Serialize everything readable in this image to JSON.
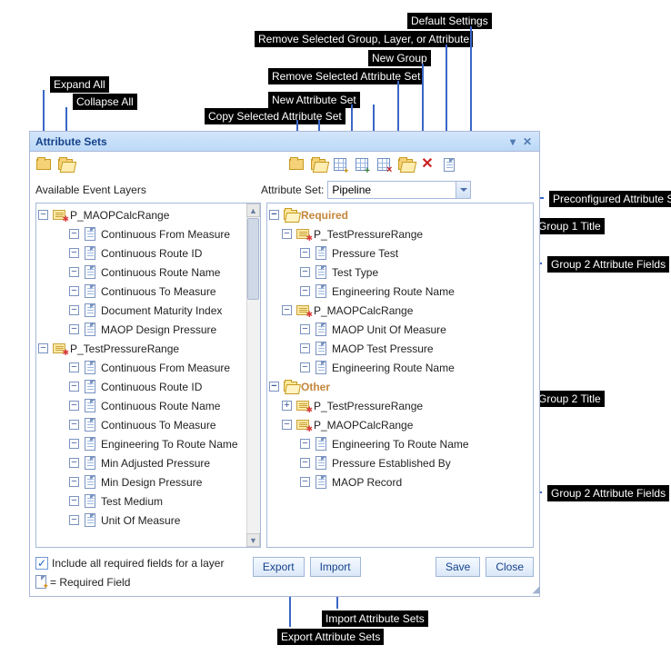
{
  "title": "Attribute Sets",
  "callouts": {
    "expand_all": "Expand All",
    "collapse_all": "Collapse All",
    "copy_selected": "Copy Selected Attribute Set",
    "new_attr_set": "New Attribute Set",
    "remove_attr_set": "Remove Selected Attribute Set",
    "new_group": "New Group",
    "remove_gla": "Remove Selected Group, Layer, or Attribute",
    "default_settings": "Default Settings",
    "preconf": "Preconfigured Attribute Sets",
    "group1_title": "Group 1 Title",
    "group2_attr_fields_a": "Group 2 Attribute Fields",
    "group2_title": "Group 2 Title",
    "group2_attr_fields_b": "Group 2 Attribute Fields",
    "import": "Import Attribute Sets",
    "export": "Export Attribute Sets"
  },
  "labels": {
    "available_layers": "Available Event Layers",
    "attribute_set": "Attribute Set:",
    "include_required": "Include all required fields for a layer",
    "required_field": "= Required Field"
  },
  "combo_value": "Pipeline",
  "buttons": {
    "export": "Export",
    "import": "Import",
    "save": "Save",
    "close": "Close"
  },
  "left_tree": [
    {
      "t": "layer",
      "label": "P_MAOPCalcRange",
      "req": true,
      "open": true
    },
    {
      "t": "attr",
      "label": "Continuous From Measure"
    },
    {
      "t": "attr",
      "label": "Continuous Route ID"
    },
    {
      "t": "attr",
      "label": "Continuous Route Name"
    },
    {
      "t": "attr",
      "label": "Continuous To Measure"
    },
    {
      "t": "attr",
      "label": "Document Maturity Index"
    },
    {
      "t": "attr",
      "label": "MAOP Design Pressure"
    },
    {
      "t": "layer",
      "label": "P_TestPressureRange",
      "req": true,
      "open": true
    },
    {
      "t": "attr",
      "label": "Continuous From Measure"
    },
    {
      "t": "attr",
      "label": "Continuous Route ID"
    },
    {
      "t": "attr",
      "label": "Continuous Route Name"
    },
    {
      "t": "attr",
      "label": "Continuous To Measure"
    },
    {
      "t": "attr",
      "label": "Engineering To Route Name"
    },
    {
      "t": "attr",
      "label": "Min Adjusted Pressure"
    },
    {
      "t": "attr",
      "label": "Min Design Pressure"
    },
    {
      "t": "attr",
      "label": "Test Medium"
    },
    {
      "t": "attr",
      "label": "Unit Of Measure"
    }
  ],
  "right_tree": {
    "groups": [
      {
        "label": "Required",
        "open": true,
        "layers": [
          {
            "label": "P_TestPressureRange",
            "req": true,
            "open": true,
            "attrs": [
              "Pressure Test",
              "Test Type",
              "Engineering Route Name"
            ]
          },
          {
            "label": "P_MAOPCalcRange",
            "req": true,
            "open": true,
            "attrs": [
              "MAOP Unit Of Measure",
              "MAOP Test Pressure",
              "Engineering Route Name"
            ]
          }
        ]
      },
      {
        "label": "Other",
        "open": true,
        "layers": [
          {
            "label": "P_TestPressureRange",
            "req": true,
            "open": false,
            "attrs": []
          },
          {
            "label": "P_MAOPCalcRange",
            "req": true,
            "open": true,
            "attrs": [
              "Engineering To Route Name",
              "Pressure Established By",
              "MAOP Record"
            ]
          }
        ]
      }
    ]
  }
}
